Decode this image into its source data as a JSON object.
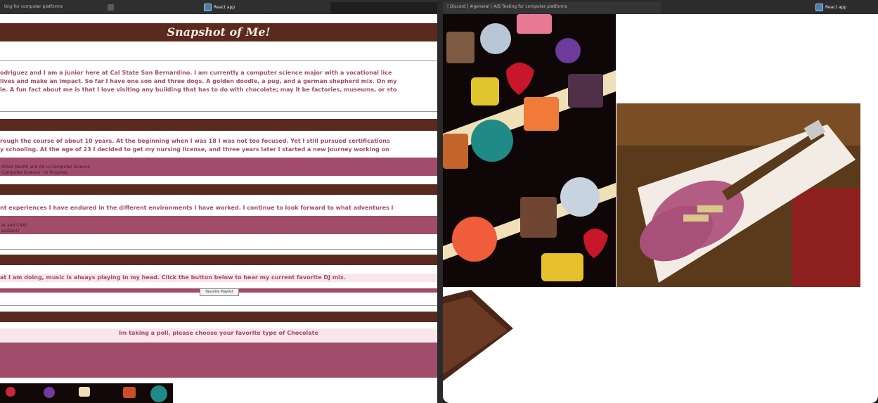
{
  "left_window": {
    "tab_label": "ting for computer platforms",
    "app_title": "React app"
  },
  "right_window": {
    "tab_label": "| Discord | #general | A/B Testing for computer platforms",
    "app_title": "React app"
  },
  "page": {
    "title": "Snapshot of Me!",
    "intro_lines": [
      "odriguez and I am a junior here at Cal State San Bernardino. I am currently a computer science major with a vocational lice",
      "lives and make an impact. So far I have one son and three dogs. A golden doodle, a pug, and a german shepherd mix. On my",
      "le. A fun fact about me is that I love visiting any building that has to do with chocolate; may it be factories, museums, or sto"
    ],
    "education_lines": [
      "rough the course of about 10 years. At the beginning when I was 18 I was not too focused. Yet I still pursued certifications",
      "y schooling. At the age of 23 I decided to get my nursing license, and three years later I started a new journey working on"
    ],
    "degrees": [
      "Allied Health and AA in Computer Science",
      "Computer Science - In Progress"
    ],
    "experience_line": "nt experiences I have endured in the different environments I have worked. I continue to look forward to what adventures l",
    "jobs": [
      "er and CNA)",
      "ssistant)"
    ],
    "music_line": "at I am doing, music is always playing in my head. Click the button below to hear my current favorite DJ mix.",
    "playlist_button": "Favorite Playlist",
    "poll_line": "Im taking a poll, please choose your favorite type of Chocolate"
  },
  "colors": {
    "brown": "#5a2a1e",
    "pink": "#a24c6b",
    "text_pink": "#a44a6a"
  },
  "icons": {
    "app_icon": "react-app-icon",
    "close_tab": "tab-close-icon"
  }
}
